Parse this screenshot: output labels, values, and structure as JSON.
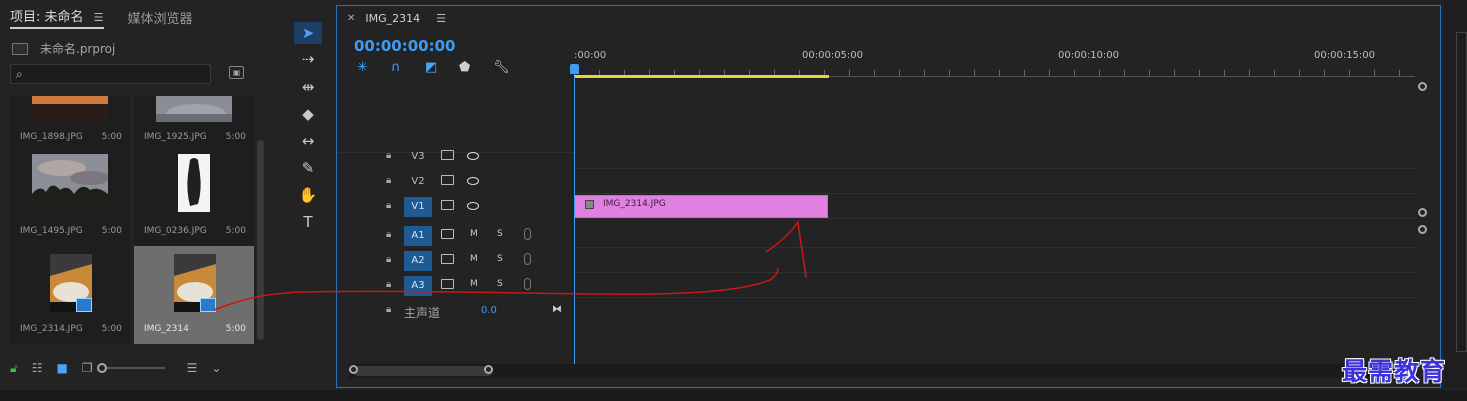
{
  "project_panel": {
    "tabs": [
      {
        "label": "项目: 未命名"
      },
      {
        "label": "媒体浏览器"
      }
    ],
    "project_file": "未命名.prproj",
    "search_placeholder": "",
    "items": [
      {
        "name": "IMG_1898.JPG",
        "duration": "5:00"
      },
      {
        "name": "IMG_1925.JPG",
        "duration": "5:00"
      },
      {
        "name": "IMG_1495.JPG",
        "duration": "5:00"
      },
      {
        "name": "IMG_0236.JPG",
        "duration": "5:00"
      },
      {
        "name": "IMG_2314.JPG",
        "duration": "5:00"
      },
      {
        "name": "IMG_2314",
        "duration": "5:00",
        "selected": true
      }
    ]
  },
  "tools": [
    "selection-tool",
    "track-select-tool",
    "ripple-edit-tool",
    "razor-tool",
    "slip-tool",
    "pen-tool",
    "hand-tool",
    "type-tool"
  ],
  "timeline": {
    "sequence_name": "IMG_2314",
    "timecode": "00:00:00:00",
    "ruler_labels": [
      ":00:00",
      "00:00:05:00",
      "00:00:10:00",
      "00:00:15:00"
    ],
    "video_tracks": [
      "V3",
      "V2",
      "V1"
    ],
    "audio_tracks": [
      "A1",
      "A2",
      "A3"
    ],
    "mute_label": "M",
    "solo_label": "S",
    "master": {
      "label": "主声道",
      "value": "0.0"
    },
    "clip": {
      "name": "IMG_2314.JPG",
      "track": "V1"
    }
  },
  "watermark": "最需教育",
  "colors": {
    "accent": "#3e9bf4",
    "clip_pink": "#e080e0",
    "work_area": "#e6d63c",
    "target_track": "#1f5a92",
    "annotation": "#c81818"
  }
}
